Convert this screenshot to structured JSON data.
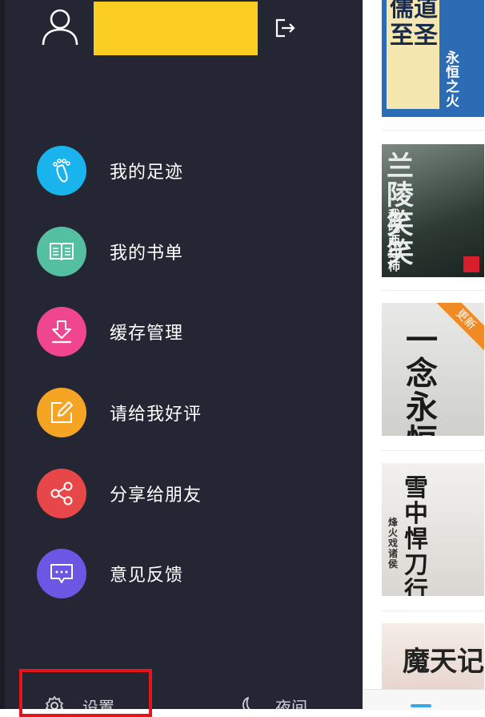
{
  "profile": {
    "avatar_icon": "user-icon",
    "logout_icon": "logout-icon"
  },
  "menu": {
    "items": [
      {
        "label": "我的足迹",
        "icon": "footprint-icon",
        "color": "#19b4ee"
      },
      {
        "label": "我的书单",
        "icon": "book-icon",
        "color": "#55c0a1"
      },
      {
        "label": "缓存管理",
        "icon": "download-icon",
        "color": "#f0468f"
      },
      {
        "label": "请给我好评",
        "icon": "edit-icon",
        "color": "#f6a424"
      },
      {
        "label": "分享给朋友",
        "icon": "share-icon",
        "color": "#e74748"
      },
      {
        "label": "意见反馈",
        "icon": "feedback-icon",
        "color": "#6c57e4"
      }
    ]
  },
  "footer": {
    "settings_label": "设置",
    "night_label": "夜间"
  },
  "books": [
    {
      "title": "儒道至圣",
      "author": "永恒之火"
    },
    {
      "title": "兰陵笑笑",
      "author": "我吃西红柿"
    },
    {
      "title": "一念永恒",
      "badge": "更新"
    },
    {
      "title": "雪中悍刀行",
      "author": "烽火戏诸侯"
    },
    {
      "title": "魔天记"
    }
  ],
  "colors": {
    "drawer_bg": "#252633",
    "accent_yellow": "#fbcd22",
    "highlight_red": "#e8141b"
  }
}
